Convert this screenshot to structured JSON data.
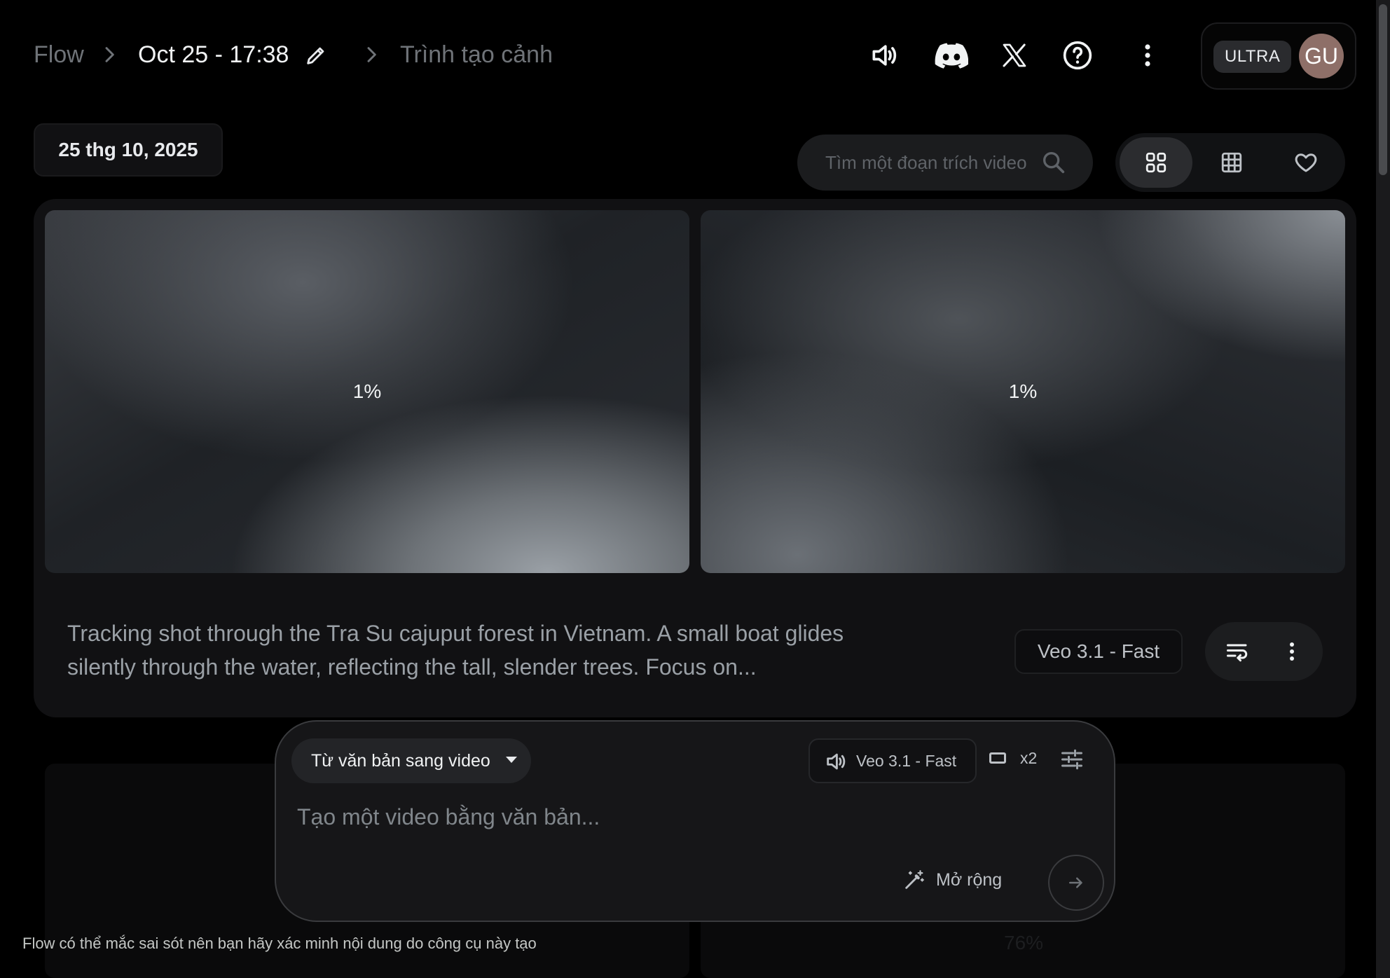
{
  "header": {
    "breadcrumb": {
      "root": "Flow",
      "title": "Oct 25 - 17:38",
      "current": "Trình tạo cảnh"
    },
    "icons": [
      "volume-icon",
      "discord-icon",
      "x-icon",
      "help-icon",
      "more-vert-icon"
    ],
    "plan_badge": "ULTRA",
    "avatar_initials": "GU"
  },
  "date_group": {
    "label": "25 thg 10, 2025"
  },
  "search": {
    "placeholder": "Tìm một đoạn trích video"
  },
  "view_toggle": {
    "active": "grid-large",
    "options": [
      "grid-large-icon",
      "grid-small-icon",
      "favorite-icon"
    ]
  },
  "card": {
    "thumbnails": [
      {
        "progress": "1%"
      },
      {
        "progress": "1%"
      }
    ],
    "prompt": "Tracking shot through the Tra Su cajuput forest in Vietnam. A small boat glides silently through the water, reflecting the tall, slender trees. Focus on...",
    "model": "Veo 3.1 - Fast"
  },
  "background_row": {
    "progress": "76%"
  },
  "composer": {
    "mode": "Từ văn bản sang video",
    "model": "Veo 3.1 - Fast",
    "count": "x2",
    "placeholder": "Tạo một video bằng văn bản...",
    "expand_label": "Mở rộng"
  },
  "footer": {
    "disclaimer": "Flow có thể mắc sai sót nên bạn hãy xác minh nội dung do công cụ này tạo"
  },
  "colors": {
    "background": "#000000",
    "card": "#111113",
    "composer": "#161618",
    "avatar": "#8e6f68"
  }
}
